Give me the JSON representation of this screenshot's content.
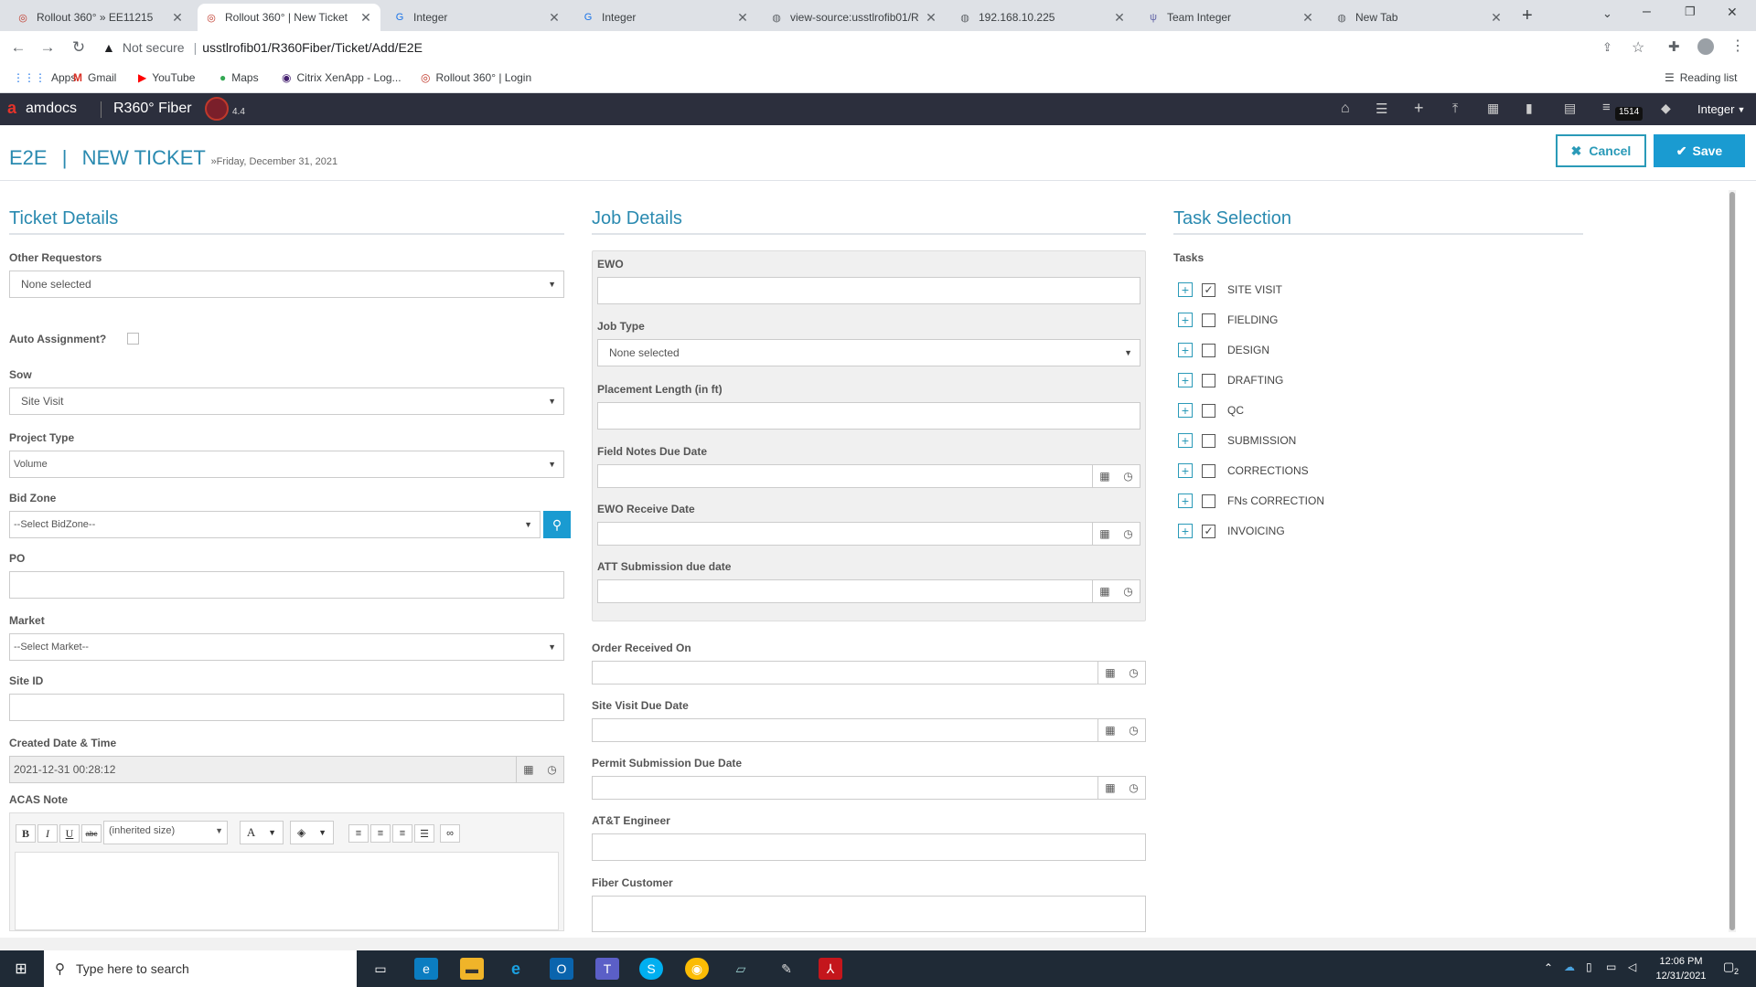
{
  "browser": {
    "tabs": [
      {
        "title": "Rollout 360° » EE11215",
        "icon": "rollout-icon"
      },
      {
        "title": "Rollout 360° | New Ticket",
        "icon": "rollout-icon",
        "active": true
      },
      {
        "title": "Integer",
        "icon": "integer-icon"
      },
      {
        "title": "Integer",
        "icon": "integer-icon"
      },
      {
        "title": "view-source:usstlrofib01/R",
        "icon": "globe-icon"
      },
      {
        "title": "192.168.10.225",
        "icon": "globe-icon"
      },
      {
        "title": "Team Integer",
        "icon": "team-icon"
      },
      {
        "title": "New Tab",
        "icon": "globe-icon"
      }
    ],
    "security_label": "Not secure",
    "url": "usstlrofib01/R360Fiber/Ticket/Add/E2E",
    "bookmarks": [
      "Apps",
      "Gmail",
      "YouTube",
      "Maps",
      "Citrix XenApp - Log...",
      "Rollout 360° | Login"
    ],
    "reading_list": "Reading list"
  },
  "app": {
    "brand": "amdocs",
    "product": "R360° Fiber",
    "version": "4.4",
    "badge_count": "1514",
    "user": "Integer"
  },
  "page": {
    "breadcrumb_root": "E2E",
    "separator": "|",
    "title": "NEW TICKET",
    "date": "»Friday, December 31, 2021",
    "cancel_label": "Cancel",
    "save_label": "Save"
  },
  "ticket": {
    "heading": "Ticket Details",
    "other_requestors_label": "Other Requestors",
    "other_requestors_value": "None selected",
    "auto_assignment_label": "Auto Assignment?",
    "sow_label": "Sow",
    "sow_value": "Site Visit",
    "project_type_label": "Project Type",
    "project_type_value": "Volume",
    "bid_zone_label": "Bid Zone",
    "bid_zone_value": "--Select BidZone--",
    "po_label": "PO",
    "market_label": "Market",
    "market_value": "--Select Market--",
    "site_id_label": "Site ID",
    "created_label": "Created Date & Time",
    "created_value": "2021-12-31 00:28:12",
    "acas_label": "ACAS Note",
    "editor_size": "(inherited size)"
  },
  "job": {
    "heading": "Job Details",
    "ewo_label": "EWO",
    "job_type_label": "Job Type",
    "job_type_value": "None selected",
    "placement_label": "Placement Length (in ft)",
    "field_notes_label": "Field Notes Due Date",
    "ewo_receive_label": "EWO Receive Date",
    "att_submission_label": "ATT Submission due date",
    "order_received_label": "Order Received On",
    "site_visit_due_label": "Site Visit Due Date",
    "permit_label": "Permit Submission Due Date",
    "engineer_label": "AT&T Engineer",
    "customer_label": "Fiber Customer"
  },
  "tasks": {
    "heading": "Task Selection",
    "label": "Tasks",
    "items": [
      {
        "name": "SITE VISIT",
        "checked": "✓"
      },
      {
        "name": "FIELDING",
        "checked": ""
      },
      {
        "name": "DESIGN",
        "checked": ""
      },
      {
        "name": "DRAFTING",
        "checked": ""
      },
      {
        "name": "QC",
        "checked": ""
      },
      {
        "name": "SUBMISSION",
        "checked": ""
      },
      {
        "name": "CORRECTIONS",
        "checked": ""
      },
      {
        "name": "FNs CORRECTION",
        "checked": ""
      },
      {
        "name": "INVOICING",
        "checked": "✓"
      }
    ]
  },
  "taskbar": {
    "search_placeholder": "Type here to search",
    "time": "12:06 PM",
    "date": "12/31/2021",
    "notifications": "2"
  },
  "colors": {
    "accent": "#2a8ab0",
    "save_bg": "#1a9bd1",
    "header_bg": "#2c2f3d"
  }
}
